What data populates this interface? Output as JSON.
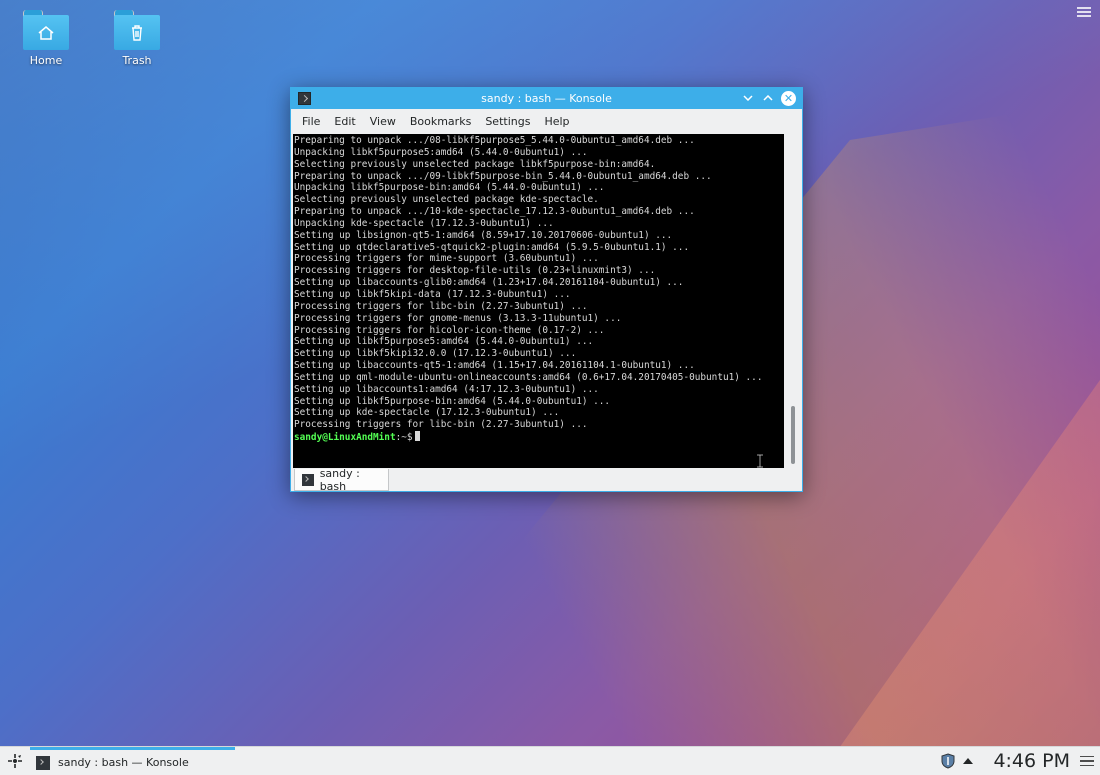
{
  "desktop": {
    "icons": [
      {
        "label": "Home",
        "icon": "home-folder-icon"
      },
      {
        "label": "Trash",
        "icon": "trash-folder-icon"
      }
    ]
  },
  "window": {
    "title": "sandy : bash — Konsole",
    "menu": [
      "File",
      "Edit",
      "View",
      "Bookmarks",
      "Settings",
      "Help"
    ],
    "terminal_lines": [
      "Preparing to unpack .../08-libkf5purpose5_5.44.0-0ubuntu1_amd64.deb ...",
      "Unpacking libkf5purpose5:amd64 (5.44.0-0ubuntu1) ...",
      "Selecting previously unselected package libkf5purpose-bin:amd64.",
      "Preparing to unpack .../09-libkf5purpose-bin_5.44.0-0ubuntu1_amd64.deb ...",
      "Unpacking libkf5purpose-bin:amd64 (5.44.0-0ubuntu1) ...",
      "Selecting previously unselected package kde-spectacle.",
      "Preparing to unpack .../10-kde-spectacle_17.12.3-0ubuntu1_amd64.deb ...",
      "Unpacking kde-spectacle (17.12.3-0ubuntu1) ...",
      "Setting up libsignon-qt5-1:amd64 (8.59+17.10.20170606-0ubuntu1) ...",
      "Setting up qtdeclarative5-qtquick2-plugin:amd64 (5.9.5-0ubuntu1.1) ...",
      "Processing triggers for mime-support (3.60ubuntu1) ...",
      "Processing triggers for desktop-file-utils (0.23+linuxmint3) ...",
      "Setting up libaccounts-glib0:amd64 (1.23+17.04.20161104-0ubuntu1) ...",
      "Setting up libkf5kipi-data (17.12.3-0ubuntu1) ...",
      "Processing triggers for libc-bin (2.27-3ubuntu1) ...",
      "Processing triggers for gnome-menus (3.13.3-11ubuntu1) ...",
      "Processing triggers for hicolor-icon-theme (0.17-2) ...",
      "Setting up libkf5purpose5:amd64 (5.44.0-0ubuntu1) ...",
      "Setting up libkf5kipi32.0.0 (17.12.3-0ubuntu1) ...",
      "Setting up libaccounts-qt5-1:amd64 (1.15+17.04.20161104.1-0ubuntu1) ...",
      "Setting up qml-module-ubuntu-onlineaccounts:amd64 (0.6+17.04.20170405-0ubuntu1) ...",
      "Setting up libaccounts1:amd64 (4:17.12.3-0ubuntu1) ...",
      "Setting up libkf5purpose-bin:amd64 (5.44.0-0ubuntu1) ...",
      "Setting up kde-spectacle (17.12.3-0ubuntu1) ...",
      "Processing triggers for libc-bin (2.27-3ubuntu1) ..."
    ],
    "prompt_user": "sandy@LinuxAndMint",
    "prompt_suffix": ":~$",
    "tab_label": "sandy : bash"
  },
  "panel": {
    "task_label": "sandy : bash — Konsole",
    "clock": "4:46 PM"
  },
  "colors": {
    "accent": "#3daee9",
    "prompt": "#54ff54"
  }
}
